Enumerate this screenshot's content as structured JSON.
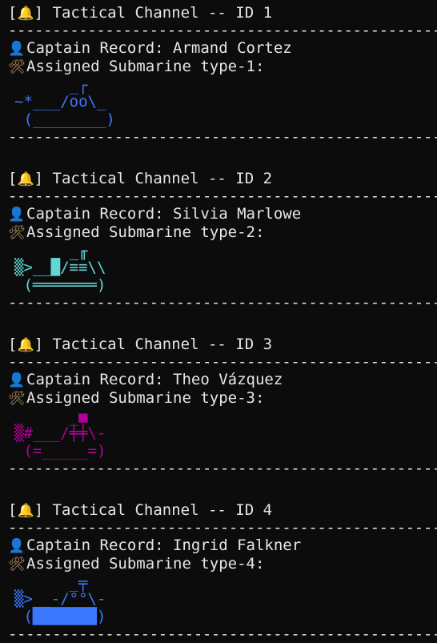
{
  "theme": {
    "background": "#0c0c0c",
    "text": "#e6e6e6",
    "art_colors": [
      "#3b78ff",
      "#61d6d6",
      "#b4009e",
      "#3b78ff"
    ]
  },
  "separator": "----------------------------------------------------",
  "channels": [
    {
      "header": "[🔔] Tactical Channel -- ID 1",
      "bell_icon": "bell-icon",
      "captain": "Captain Record: Armand Cortez",
      "submarine": "Assigned Submarine type-1:",
      "art": [
        "      _┌",
        "~*___/oo\\_",
        " (________)"
      ]
    },
    {
      "header": "[🔔] Tactical Channel -- ID 2",
      "bell_icon": "bell-icon",
      "captain": "Captain Record: Silvia Marlowe",
      "submarine": "Assigned Submarine type-2:",
      "art": [
        "      _╓",
        "▒>__█/≡≡\\\\",
        " (═══════)"
      ]
    },
    {
      "header": "[🔔] Tactical Channel -- ID 3",
      "bell_icon": "bell-icon",
      "captain": "Captain Record: Theo Vázquez",
      "submarine": "Assigned Submarine type-3:",
      "art": [
        "      _■",
        "▒#___/╪╪\\-",
        " (=_____=)"
      ]
    },
    {
      "header": "[🔔] Tactical Channel -- ID 4",
      "bell_icon": "bell-icon",
      "captain": "Captain Record: Ingrid Falkner",
      "submarine": "Assigned Submarine type-4:",
      "art": [
        "      _╤",
        "▒>__-/°°\\-",
        " (███████)"
      ]
    }
  ],
  "icons": {
    "captain": "person-icon",
    "submarine": "tools-icon"
  }
}
